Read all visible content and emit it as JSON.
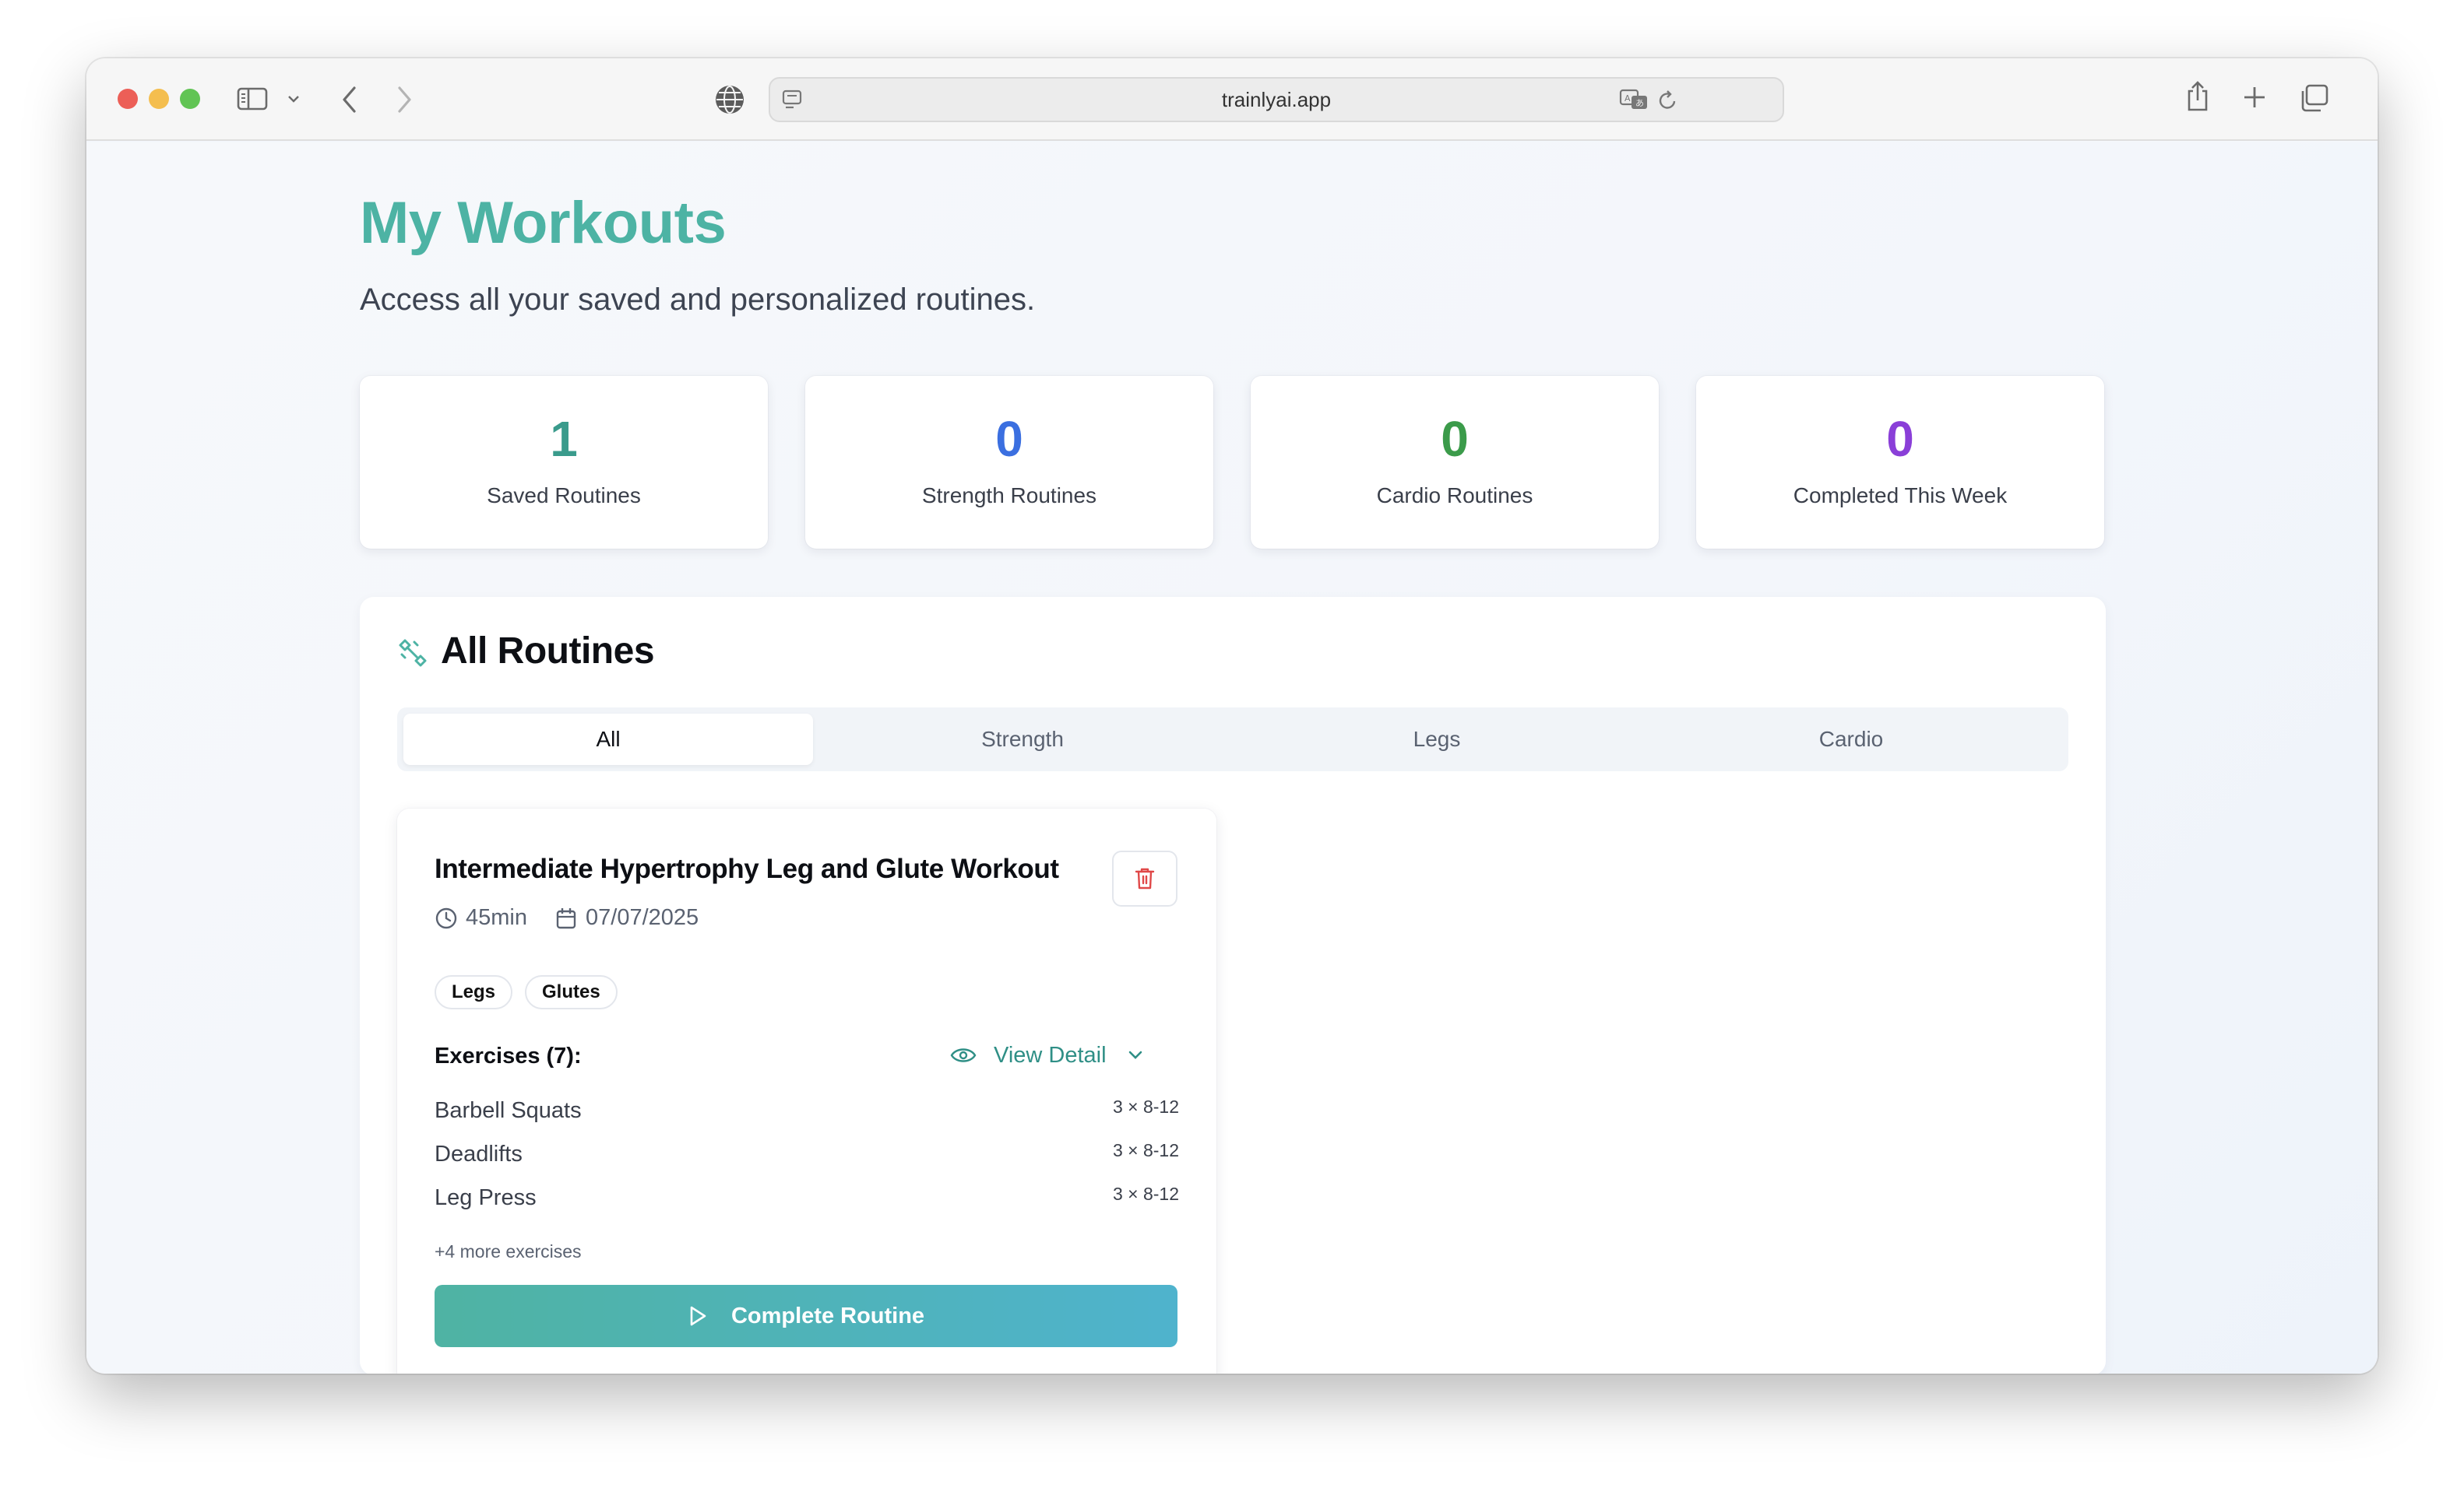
{
  "browser": {
    "url": "trainlyai.app"
  },
  "page": {
    "title": "My Workouts",
    "subtitle": "Access all your saved and personalized routines."
  },
  "stats": [
    {
      "value": "1",
      "label": "Saved Routines",
      "color": "#3a9b8c"
    },
    {
      "value": "0",
      "label": "Strength Routines",
      "color": "#3b6fe0"
    },
    {
      "value": "0",
      "label": "Cardio Routines",
      "color": "#3b9b4a"
    },
    {
      "value": "0",
      "label": "Completed This Week",
      "color": "#8a3fd8"
    }
  ],
  "routines_panel": {
    "title": "All Routines",
    "title_icon": "dumbbell-icon",
    "tabs": [
      "All",
      "Strength",
      "Legs",
      "Cardio"
    ],
    "active_tab": "All"
  },
  "routine": {
    "title": "Intermediate Hypertrophy Leg and Glute Workout",
    "duration": "45min",
    "date": "07/07/2025",
    "tags": [
      "Legs",
      "Glutes"
    ],
    "exercises_heading": "Exercises (7):",
    "view_detail_label": "View Detail",
    "exercises": [
      {
        "name": "Barbell Squats",
        "sets": "3 × 8-12"
      },
      {
        "name": "Deadlifts",
        "sets": "3 × 8-12"
      },
      {
        "name": "Leg Press",
        "sets": "3 × 8-12"
      }
    ],
    "more_exercises": "+4 more exercises",
    "complete_label": "Complete Routine"
  },
  "colors": {
    "accent": "#4db3a4",
    "delete": "#e04848",
    "button_gradient_start": "#4fb3a3",
    "button_gradient_end": "#4fb3cd"
  }
}
